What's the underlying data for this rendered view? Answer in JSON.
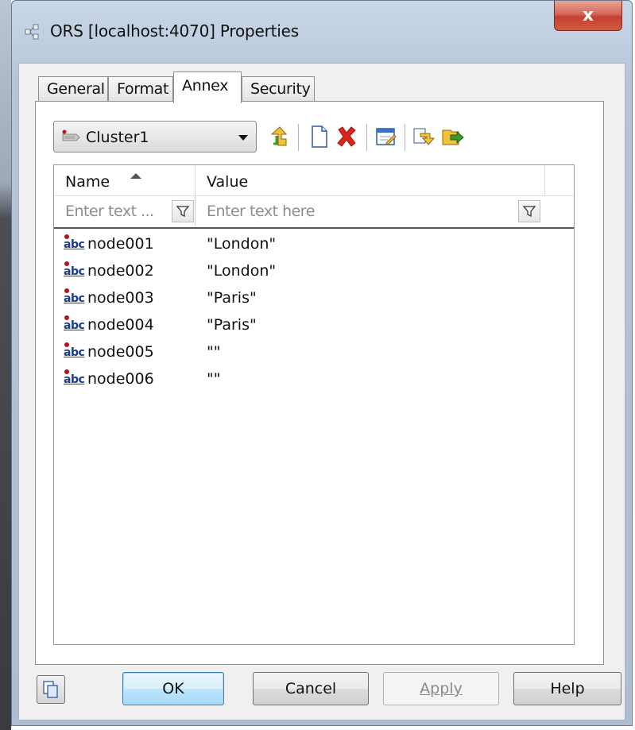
{
  "window": {
    "title": "ORS [localhost:4070] Properties",
    "close_glyph": "x"
  },
  "tabs": [
    {
      "label": "General",
      "active": false
    },
    {
      "label": "Format",
      "active": false
    },
    {
      "label": "Annex",
      "active": true
    },
    {
      "label": "Security",
      "active": false
    }
  ],
  "toolbar": {
    "section_select_value": "Cluster1",
    "icons": [
      "move-up-icon",
      "new-document-icon",
      "delete-icon",
      "edit-icon",
      "copy-icon",
      "paste-icon"
    ]
  },
  "grid": {
    "columns": {
      "name": "Name",
      "value": "Value"
    },
    "sort": {
      "column": "name",
      "direction": "ascending"
    },
    "filter_placeholders": {
      "name": "Enter text ...",
      "value": "Enter text here"
    },
    "rows": [
      {
        "type_icon": "abc",
        "name": "node001",
        "value": "\"London\""
      },
      {
        "type_icon": "abc",
        "name": "node002",
        "value": "\"London\""
      },
      {
        "type_icon": "abc",
        "name": "node003",
        "value": "\"Paris\""
      },
      {
        "type_icon": "abc",
        "name": "node004",
        "value": "\"Paris\""
      },
      {
        "type_icon": "abc",
        "name": "node005",
        "value": "\"\""
      },
      {
        "type_icon": "abc",
        "name": "node006",
        "value": "\"\""
      }
    ]
  },
  "footer": {
    "ok": "OK",
    "cancel": "Cancel",
    "apply": "Apply",
    "help": "Help"
  },
  "colors": {
    "accent_delete": "#d8261c",
    "accent_arrow": "#3c9a2a",
    "ok_border": "#3c7fb1"
  }
}
